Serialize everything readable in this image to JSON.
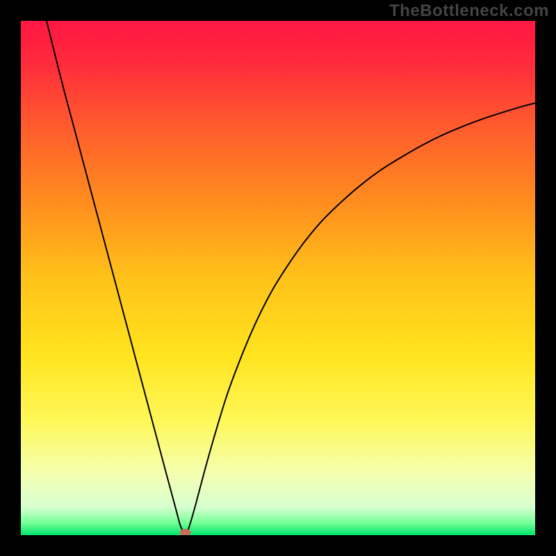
{
  "watermark": "TheBottleneck.com",
  "chart_data": {
    "type": "line",
    "title": "",
    "xlabel": "",
    "ylabel": "",
    "xlim": [
      0,
      100
    ],
    "ylim": [
      0,
      100
    ],
    "grid": false,
    "legend": false,
    "background_gradient": {
      "stops": [
        {
          "offset": 0.0,
          "color": "#ff1744"
        },
        {
          "offset": 0.08,
          "color": "#ff2a3c"
        },
        {
          "offset": 0.2,
          "color": "#ff5a2e"
        },
        {
          "offset": 0.35,
          "color": "#ff8c1e"
        },
        {
          "offset": 0.5,
          "color": "#ffc21a"
        },
        {
          "offset": 0.65,
          "color": "#ffe41e"
        },
        {
          "offset": 0.78,
          "color": "#fff85a"
        },
        {
          "offset": 0.88,
          "color": "#f4ffb0"
        },
        {
          "offset": 0.945,
          "color": "#d8ffd0"
        },
        {
          "offset": 0.975,
          "color": "#7aff9a"
        },
        {
          "offset": 1.0,
          "color": "#00e56a"
        }
      ]
    },
    "series": [
      {
        "name": "curve",
        "stroke": "#000000",
        "stroke_width": 2,
        "x": [
          5,
          6,
          8,
          10,
          12,
          14,
          16,
          18,
          20,
          22,
          24,
          26,
          28,
          29,
          30,
          30.5,
          31,
          31.5,
          32,
          32.5,
          33,
          34,
          36,
          38,
          40,
          42,
          44,
          46,
          48,
          50,
          54,
          58,
          62,
          66,
          70,
          74,
          78,
          82,
          86,
          90,
          94,
          98,
          100
        ],
        "y": [
          100,
          96,
          88,
          80.5,
          73,
          65.5,
          58,
          50.5,
          43,
          35.5,
          28,
          20.5,
          13,
          9.3,
          5.6,
          3.7,
          1.9,
          0.8,
          0.0,
          1.0,
          2.5,
          6.0,
          13.5,
          20.5,
          27.0,
          32.5,
          37.5,
          42.0,
          46.0,
          49.5,
          55.5,
          60.5,
          64.5,
          68.0,
          71.0,
          73.5,
          75.8,
          77.8,
          79.5,
          81.0,
          82.3,
          83.5,
          84.0
        ]
      }
    ],
    "marker": {
      "name": "min-marker",
      "x": 32,
      "y": 0,
      "rx": 8,
      "ry": 5,
      "fill": "#c96a5a"
    }
  }
}
